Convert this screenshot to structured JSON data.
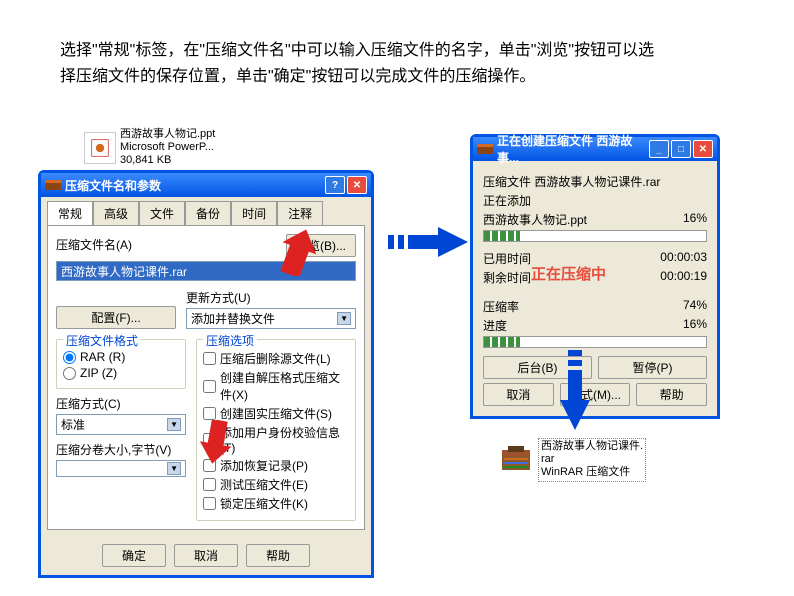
{
  "instruction": "选择\"常规\"标签，在\"压缩文件名\"中可以输入压缩文件的名字，单击\"浏览\"按钮可以选择压缩文件的保存位置，单击\"确定\"按钮可以完成文件的压缩操作。",
  "ppt_file": {
    "name": "西游故事人物记.ppt",
    "type": "Microsoft PowerP...",
    "size": "30,841 KB"
  },
  "dialog1": {
    "title": "压缩文件名和参数",
    "tabs": [
      "常规",
      "高级",
      "文件",
      "备份",
      "时间",
      "注释"
    ],
    "filename_label": "压缩文件名(A)",
    "browse_btn": "浏览(B)...",
    "filename_value": "西游故事人物记课件.rar",
    "config_btn": "配置(F)...",
    "update_label": "更新方式(U)",
    "update_value": "添加并替换文件",
    "format_group": "压缩文件格式",
    "format_rar": "RAR (R)",
    "format_zip": "ZIP (Z)",
    "options_group": "压缩选项",
    "opts": [
      "压缩后删除源文件(L)",
      "创建自解压格式压缩文件(X)",
      "创建固实压缩文件(S)",
      "添加用户身份校验信息(T)",
      "添加恢复记录(P)",
      "测试压缩文件(E)",
      "锁定压缩文件(K)"
    ],
    "method_label": "压缩方式(C)",
    "method_value": "标准",
    "volume_label": "压缩分卷大小,字节(V)",
    "ok_btn": "确定",
    "cancel_btn": "取消",
    "help_btn": "帮助"
  },
  "dialog2": {
    "title": "正在创建压缩文件 西游故事...",
    "lines": {
      "archive_label": "压缩文件",
      "archive_value": "西游故事人物记课件.rar",
      "adding_label": "正在添加",
      "current_file": "西游故事人物记.ppt",
      "current_pct": "16%",
      "elapsed_label": "已用时间",
      "elapsed_value": "00:00:03",
      "remaining_label": "剩余时间",
      "remaining_value": "00:00:19",
      "ratio_label": "压缩率",
      "ratio_value": "74%",
      "progress_label": "进度",
      "progress_value": "16%"
    },
    "compressing_text": "正在压缩中",
    "bg_btn": "后台(B)",
    "pause_btn": "暂停(P)",
    "cancel_btn": "取消",
    "mode_btn": "模式(M)...",
    "help_btn": "帮助"
  },
  "rar_file": {
    "name": "西游故事人物记课件.",
    "ext": "rar",
    "type": "WinRAR 压缩文件"
  }
}
